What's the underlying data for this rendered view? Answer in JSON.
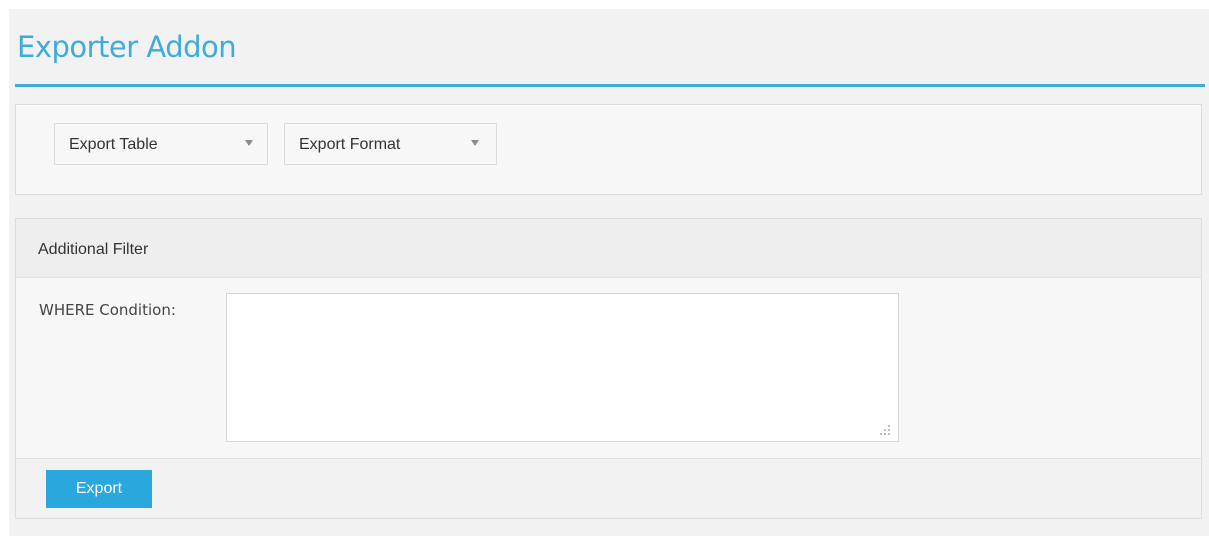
{
  "page": {
    "title": "Exporter Addon",
    "accent_color": "#3eabd8"
  },
  "selects": {
    "export_table": {
      "label": "Export Table",
      "icon": "caret-down-icon"
    },
    "export_format": {
      "label": "Export Format",
      "icon": "caret-down-icon"
    }
  },
  "filter": {
    "title": "Additional Filter",
    "where_label": "WHERE Condition:",
    "where_value": ""
  },
  "actions": {
    "export_label": "Export",
    "button_color": "#2aa7dd"
  }
}
